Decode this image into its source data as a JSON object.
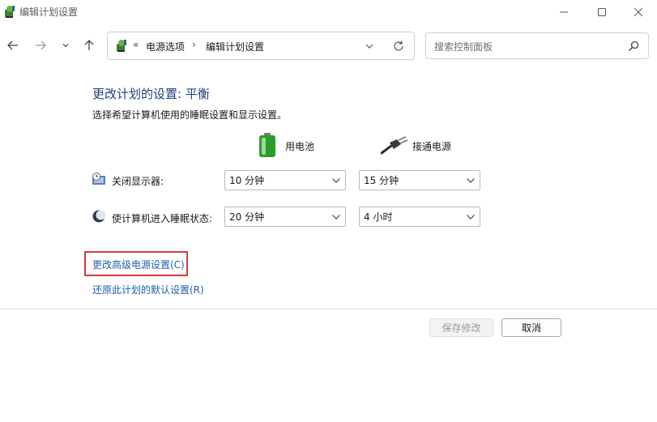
{
  "window": {
    "title": "编辑计划设置"
  },
  "address": {
    "chevron": "«",
    "crumbs": [
      "电源选项",
      "编辑计划设置"
    ],
    "separator": "›"
  },
  "search": {
    "placeholder": "搜索控制面板"
  },
  "content": {
    "heading": "更改计划的设置: 平衡",
    "subtext": "选择希望计算机使用的睡眠设置和显示设置。",
    "columns": {
      "battery": "用电池",
      "plugged": "接通电源"
    },
    "rows": [
      {
        "label": "关闭显示器:",
        "battery_value": "10 分钟",
        "plugged_value": "15 分钟"
      },
      {
        "label": "使计算机进入睡眠状态:",
        "battery_value": "20 分钟",
        "plugged_value": "4 小时"
      }
    ],
    "links": {
      "advanced": "更改高级电源设置(C)",
      "restore": "还原此计划的默认设置(R)"
    }
  },
  "buttons": {
    "save": "保存修改",
    "cancel": "取消"
  },
  "colors": {
    "heading": "#1e3f7a",
    "link": "#1f5fb0",
    "highlight_border": "#d63b3b"
  }
}
